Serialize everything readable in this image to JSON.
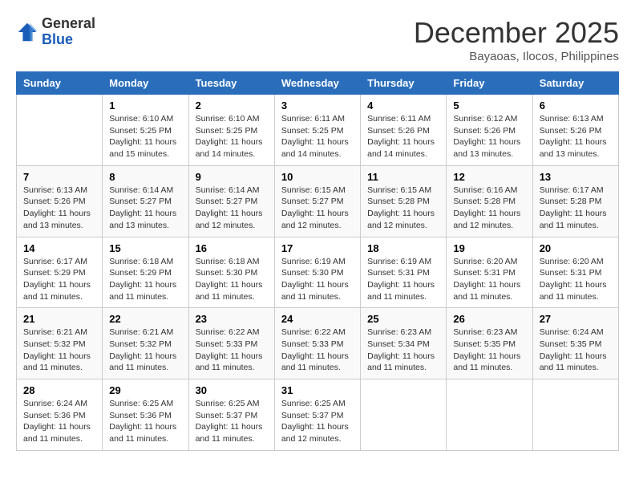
{
  "header": {
    "logo_line1": "General",
    "logo_line2": "Blue",
    "month": "December 2025",
    "location": "Bayaoas, Ilocos, Philippines"
  },
  "weekdays": [
    "Sunday",
    "Monday",
    "Tuesday",
    "Wednesday",
    "Thursday",
    "Friday",
    "Saturday"
  ],
  "weeks": [
    [
      {
        "day": "",
        "info": ""
      },
      {
        "day": "1",
        "info": "Sunrise: 6:10 AM\nSunset: 5:25 PM\nDaylight: 11 hours\nand 15 minutes."
      },
      {
        "day": "2",
        "info": "Sunrise: 6:10 AM\nSunset: 5:25 PM\nDaylight: 11 hours\nand 14 minutes."
      },
      {
        "day": "3",
        "info": "Sunrise: 6:11 AM\nSunset: 5:25 PM\nDaylight: 11 hours\nand 14 minutes."
      },
      {
        "day": "4",
        "info": "Sunrise: 6:11 AM\nSunset: 5:26 PM\nDaylight: 11 hours\nand 14 minutes."
      },
      {
        "day": "5",
        "info": "Sunrise: 6:12 AM\nSunset: 5:26 PM\nDaylight: 11 hours\nand 13 minutes."
      },
      {
        "day": "6",
        "info": "Sunrise: 6:13 AM\nSunset: 5:26 PM\nDaylight: 11 hours\nand 13 minutes."
      }
    ],
    [
      {
        "day": "7",
        "info": "Sunrise: 6:13 AM\nSunset: 5:26 PM\nDaylight: 11 hours\nand 13 minutes."
      },
      {
        "day": "8",
        "info": "Sunrise: 6:14 AM\nSunset: 5:27 PM\nDaylight: 11 hours\nand 13 minutes."
      },
      {
        "day": "9",
        "info": "Sunrise: 6:14 AM\nSunset: 5:27 PM\nDaylight: 11 hours\nand 12 minutes."
      },
      {
        "day": "10",
        "info": "Sunrise: 6:15 AM\nSunset: 5:27 PM\nDaylight: 11 hours\nand 12 minutes."
      },
      {
        "day": "11",
        "info": "Sunrise: 6:15 AM\nSunset: 5:28 PM\nDaylight: 11 hours\nand 12 minutes."
      },
      {
        "day": "12",
        "info": "Sunrise: 6:16 AM\nSunset: 5:28 PM\nDaylight: 11 hours\nand 12 minutes."
      },
      {
        "day": "13",
        "info": "Sunrise: 6:17 AM\nSunset: 5:28 PM\nDaylight: 11 hours\nand 11 minutes."
      }
    ],
    [
      {
        "day": "14",
        "info": "Sunrise: 6:17 AM\nSunset: 5:29 PM\nDaylight: 11 hours\nand 11 minutes."
      },
      {
        "day": "15",
        "info": "Sunrise: 6:18 AM\nSunset: 5:29 PM\nDaylight: 11 hours\nand 11 minutes."
      },
      {
        "day": "16",
        "info": "Sunrise: 6:18 AM\nSunset: 5:30 PM\nDaylight: 11 hours\nand 11 minutes."
      },
      {
        "day": "17",
        "info": "Sunrise: 6:19 AM\nSunset: 5:30 PM\nDaylight: 11 hours\nand 11 minutes."
      },
      {
        "day": "18",
        "info": "Sunrise: 6:19 AM\nSunset: 5:31 PM\nDaylight: 11 hours\nand 11 minutes."
      },
      {
        "day": "19",
        "info": "Sunrise: 6:20 AM\nSunset: 5:31 PM\nDaylight: 11 hours\nand 11 minutes."
      },
      {
        "day": "20",
        "info": "Sunrise: 6:20 AM\nSunset: 5:31 PM\nDaylight: 11 hours\nand 11 minutes."
      }
    ],
    [
      {
        "day": "21",
        "info": "Sunrise: 6:21 AM\nSunset: 5:32 PM\nDaylight: 11 hours\nand 11 minutes."
      },
      {
        "day": "22",
        "info": "Sunrise: 6:21 AM\nSunset: 5:32 PM\nDaylight: 11 hours\nand 11 minutes."
      },
      {
        "day": "23",
        "info": "Sunrise: 6:22 AM\nSunset: 5:33 PM\nDaylight: 11 hours\nand 11 minutes."
      },
      {
        "day": "24",
        "info": "Sunrise: 6:22 AM\nSunset: 5:33 PM\nDaylight: 11 hours\nand 11 minutes."
      },
      {
        "day": "25",
        "info": "Sunrise: 6:23 AM\nSunset: 5:34 PM\nDaylight: 11 hours\nand 11 minutes."
      },
      {
        "day": "26",
        "info": "Sunrise: 6:23 AM\nSunset: 5:35 PM\nDaylight: 11 hours\nand 11 minutes."
      },
      {
        "day": "27",
        "info": "Sunrise: 6:24 AM\nSunset: 5:35 PM\nDaylight: 11 hours\nand 11 minutes."
      }
    ],
    [
      {
        "day": "28",
        "info": "Sunrise: 6:24 AM\nSunset: 5:36 PM\nDaylight: 11 hours\nand 11 minutes."
      },
      {
        "day": "29",
        "info": "Sunrise: 6:25 AM\nSunset: 5:36 PM\nDaylight: 11 hours\nand 11 minutes."
      },
      {
        "day": "30",
        "info": "Sunrise: 6:25 AM\nSunset: 5:37 PM\nDaylight: 11 hours\nand 11 minutes."
      },
      {
        "day": "31",
        "info": "Sunrise: 6:25 AM\nSunset: 5:37 PM\nDaylight: 11 hours\nand 12 minutes."
      },
      {
        "day": "",
        "info": ""
      },
      {
        "day": "",
        "info": ""
      },
      {
        "day": "",
        "info": ""
      }
    ]
  ]
}
